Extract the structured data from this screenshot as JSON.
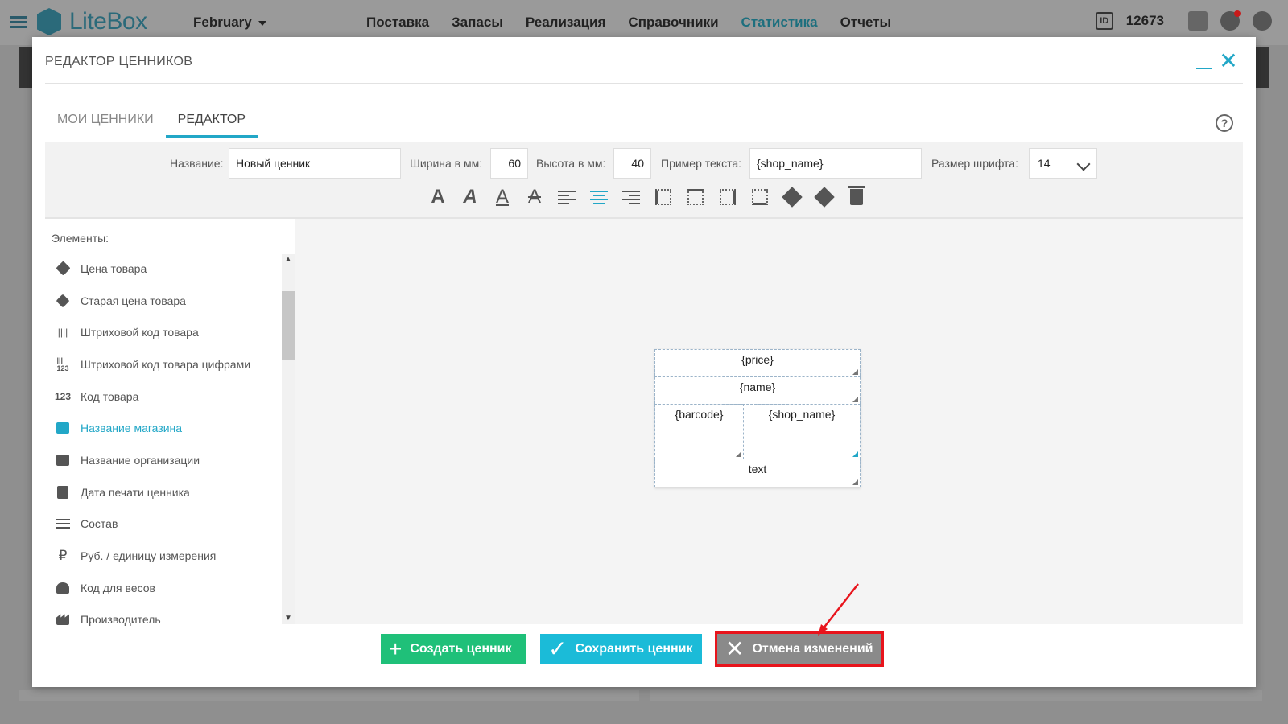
{
  "app": {
    "logo_text": "LiteBox",
    "period": "February",
    "nav": [
      "Поставка",
      "Запасы",
      "Реализация",
      "Справочники",
      "Статистика",
      "Отчеты"
    ],
    "active_nav": "Статистика",
    "id_label": "ID",
    "user_id": "12673"
  },
  "modal": {
    "title": "РЕДАКТОР ЦЕННИКОВ",
    "tabs": [
      {
        "label": "МОИ ЦЕННИКИ",
        "active": false
      },
      {
        "label": "РЕДАКТОР",
        "active": true
      }
    ],
    "help_symbol": "?"
  },
  "toolbar": {
    "name_label": "Название:",
    "name_value": "Новый ценник",
    "width_label": "Ширина в мм:",
    "width_value": "60",
    "height_label": "Высота в мм:",
    "height_value": "40",
    "sample_label": "Пример текста:",
    "sample_value": "{shop_name}",
    "font_size_label": "Размер шрифта:",
    "font_size_value": "14",
    "format_buttons": [
      "bold",
      "italic",
      "underline",
      "strikethrough",
      "align-left",
      "align-center",
      "align-right",
      "border-left",
      "border-top",
      "border-right",
      "border-bottom",
      "layer-up",
      "layer-down",
      "delete"
    ],
    "active_format": "align-center"
  },
  "elements": {
    "label": "Элементы:",
    "items": [
      {
        "label": "Цена товара",
        "icon": "tag-icon",
        "active": false
      },
      {
        "label": "Старая цена товара",
        "icon": "tags-icon",
        "active": false
      },
      {
        "label": "Штриховой код товара",
        "icon": "barcode-icon",
        "active": false
      },
      {
        "label": "Штриховой код товара цифрами",
        "icon": "barcode-digits-icon",
        "active": false
      },
      {
        "label": "Код товара",
        "icon": "numbers-icon",
        "icon_text": "123",
        "active": false
      },
      {
        "label": "Название магазина",
        "icon": "store-icon",
        "active": true
      },
      {
        "label": "Название организации",
        "icon": "building-icon",
        "active": false
      },
      {
        "label": "Дата печати ценника",
        "icon": "calendar-icon",
        "active": false
      },
      {
        "label": "Состав",
        "icon": "list-icon",
        "active": false
      },
      {
        "label": "Руб. / единицу измерения",
        "icon": "ruble-icon",
        "active": false
      },
      {
        "label": "Код для весов",
        "icon": "scales-icon",
        "active": false
      },
      {
        "label": "Производитель",
        "icon": "factory-icon",
        "active": false
      }
    ]
  },
  "canvas": {
    "cells": [
      "{price}",
      "{name}",
      "{barcode}",
      "{shop_name}",
      "text"
    ],
    "selected": "{shop_name}"
  },
  "footer": {
    "create_label": "Создать ценник",
    "save_label": "Сохранить ценник",
    "cancel_label": "Отмена изменений"
  },
  "colors": {
    "accent": "#22a7c7",
    "create": "#1fc079",
    "save": "#1bbbd8",
    "cancel": "#8a8a8a",
    "highlight": "#e8141c"
  }
}
